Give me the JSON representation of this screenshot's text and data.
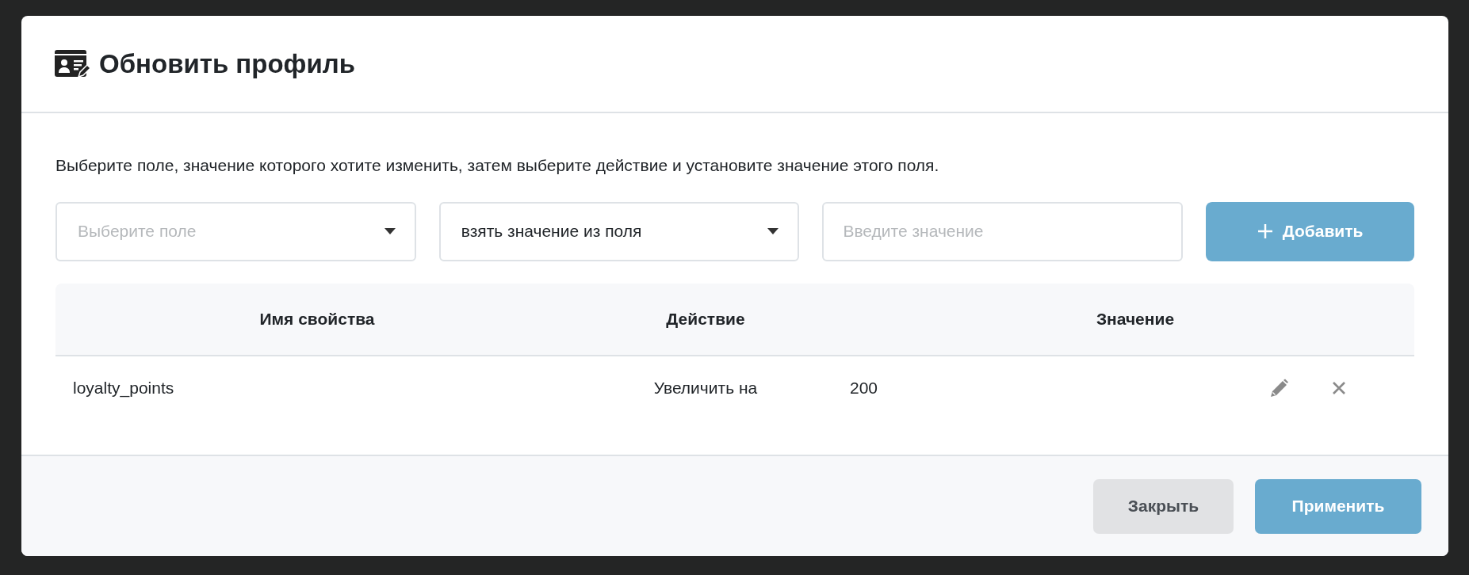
{
  "dialog": {
    "title": "Обновить профиль",
    "description": "Выберите поле, значение которого хотите изменить, затем выберите действие и установите значение этого поля.",
    "field_select": {
      "placeholder": "Выберите поле"
    },
    "action_select": {
      "value": "взять значение из поля"
    },
    "value_input": {
      "placeholder": "Введите значение"
    },
    "add_button": {
      "label": "Добавить"
    },
    "table": {
      "columns": [
        "Имя свойства",
        "Действие",
        "Значение"
      ],
      "rows": [
        {
          "property": "loyalty_points",
          "action": "Увеличить на",
          "value": "200"
        }
      ]
    },
    "buttons": [
      {
        "label": "Закрыть",
        "kind": "secondary"
      },
      {
        "label": "Применить",
        "kind": "primary"
      }
    ]
  }
}
